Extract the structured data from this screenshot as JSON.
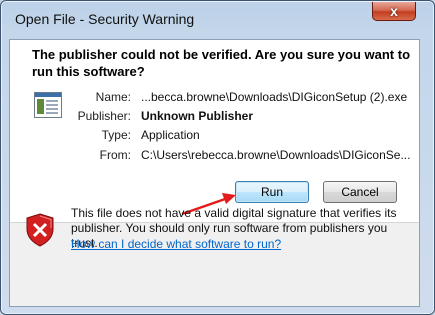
{
  "window": {
    "title": "Open File - Security Warning",
    "close_glyph": "x"
  },
  "heading": "The publisher could not be verified.  Are you sure you want to run this software?",
  "details": {
    "name_label": "Name:",
    "name_value": "...becca.browne\\Downloads\\DIGiconSetup (2).exe",
    "publisher_label": "Publisher:",
    "publisher_value": "Unknown Publisher",
    "type_label": "Type:",
    "type_value": "Application",
    "from_label": "From:",
    "from_value": "C:\\Users\\rebecca.browne\\Downloads\\DIGiconSe..."
  },
  "buttons": {
    "run": "Run",
    "cancel": "Cancel"
  },
  "warning": {
    "text": "This file does not have a valid digital signature that verifies its publisher.  You should only run software from publishers you trust.",
    "link": "How can I decide what software to run?"
  },
  "icons": {
    "file": "file-app-icon",
    "shield": "shield-error-icon",
    "annotation": "red-arrow"
  },
  "colors": {
    "accent": "#0066cc",
    "shield_red": "#d21f1f",
    "arrow_red": "#e31b1b"
  }
}
